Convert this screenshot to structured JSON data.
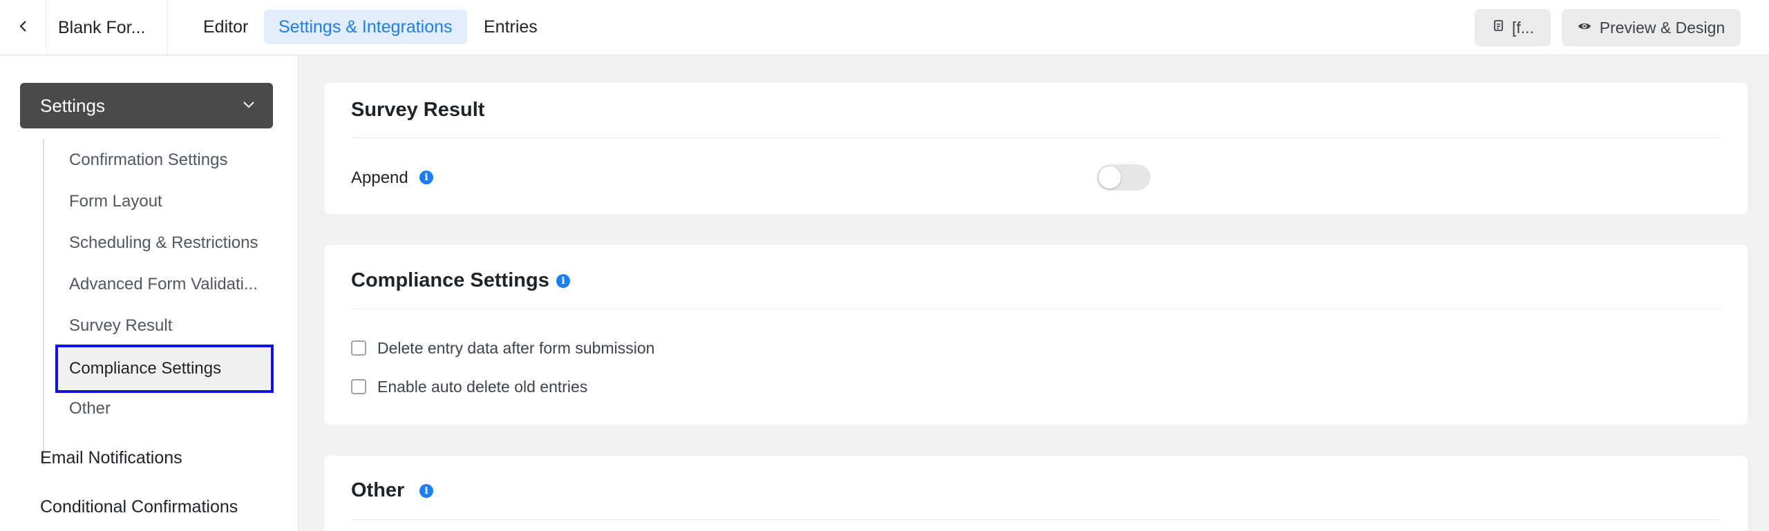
{
  "header": {
    "back_icon": "chevron-left-icon",
    "form_title": "Blank For...",
    "tabs": [
      {
        "label": "Editor",
        "active": false
      },
      {
        "label": "Settings & Integrations",
        "active": true
      },
      {
        "label": "Entries",
        "active": false
      }
    ],
    "shortcode_label": "[f...",
    "shortcode_icon": "copy-icon",
    "preview_label": "Preview & Design",
    "preview_icon": "eye-icon",
    "accent_color": "#1a7efb"
  },
  "sidebar": {
    "section_title": "Settings",
    "section_icon": "chevron-down-icon",
    "sub_items": [
      {
        "label": "Confirmation Settings"
      },
      {
        "label": "Form Layout"
      },
      {
        "label": "Scheduling & Restrictions"
      },
      {
        "label": "Advanced Form Validati..."
      },
      {
        "label": "Survey Result"
      },
      {
        "label": "Compliance Settings",
        "active": true
      },
      {
        "label": "Other"
      }
    ],
    "links": [
      {
        "label": "Email Notifications"
      },
      {
        "label": "Conditional Confirmations"
      }
    ]
  },
  "main": {
    "survey_result": {
      "title": "Survey Result",
      "append_label": "Append",
      "append_enabled": false
    },
    "compliance": {
      "title": "Compliance Settings",
      "options": [
        {
          "label": "Delete entry data after form submission",
          "checked": false
        },
        {
          "label": "Enable auto delete old entries",
          "checked": false
        }
      ]
    },
    "other": {
      "title": "Other"
    }
  }
}
